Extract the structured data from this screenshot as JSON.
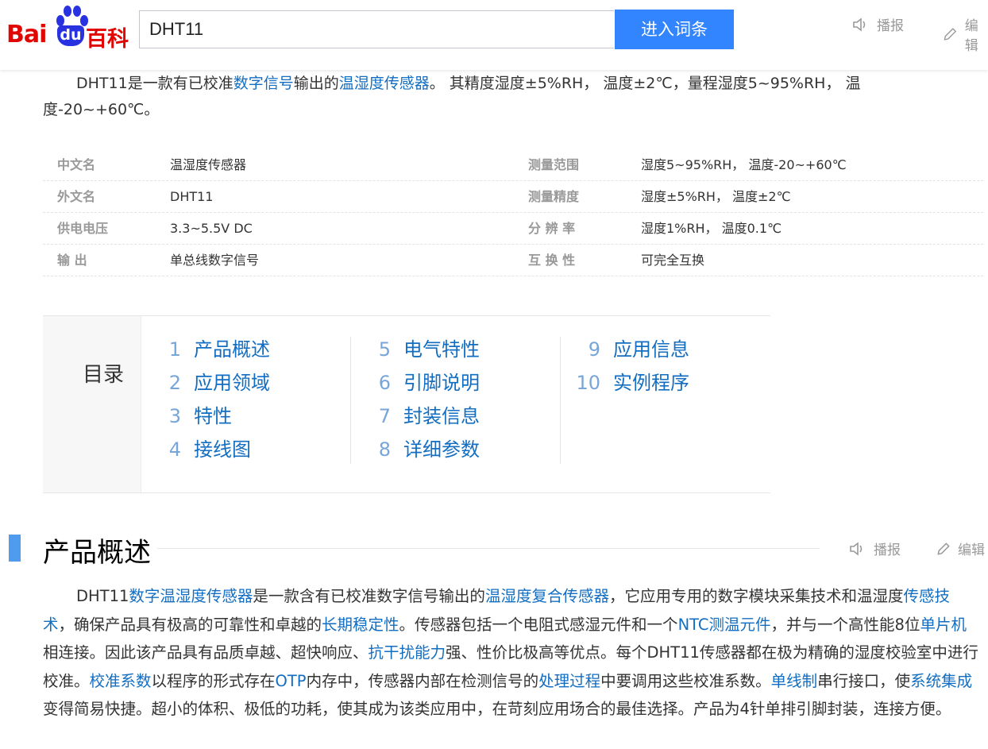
{
  "header": {
    "logo": {
      "bai": "Bai",
      "du": "du",
      "baike": "百科"
    },
    "search_value": "DHT11",
    "search_button": "进入词条",
    "actions": {
      "broadcast": "播报",
      "edit": "编辑"
    }
  },
  "intro": {
    "p1": "DHT11是一款有已校准",
    "link1": "数字信号",
    "p2": "输出的",
    "link2": "温湿度传感器",
    "p3": "。 其精度湿度±5%RH， 温度±2℃，量程湿度5~95%RH， 温度-20~+60℃。"
  },
  "basic_info": [
    {
      "k1": "中文名",
      "v1": "温湿度传感器",
      "k2": "测量范围",
      "v2": "湿度5~95%RH， 温度-20~+60℃"
    },
    {
      "k1": "外文名",
      "v1": "DHT11",
      "k2": "测量精度",
      "v2": "湿度±5%RH， 温度±2℃"
    },
    {
      "k1": "供电电压",
      "v1": "3.3~5.5V DC",
      "k2": "分 辨 率",
      "v2": "湿度1%RH， 温度0.1℃"
    },
    {
      "k1": "输 出",
      "v1": "单总线数字信号",
      "k2": "互 换 性",
      "v2": "可完全互换"
    }
  ],
  "catalog": {
    "title": "目录",
    "items": [
      {
        "num": "1",
        "label": "产品概述"
      },
      {
        "num": "2",
        "label": "应用领域"
      },
      {
        "num": "3",
        "label": "特性"
      },
      {
        "num": "4",
        "label": "接线图"
      },
      {
        "num": "5",
        "label": "电气特性"
      },
      {
        "num": "6",
        "label": "引脚说明"
      },
      {
        "num": "7",
        "label": "封装信息"
      },
      {
        "num": "8",
        "label": "详细参数"
      },
      {
        "num": "9",
        "label": "应用信息"
      },
      {
        "num": "10",
        "label": "实例程序"
      }
    ]
  },
  "section": {
    "title": "产品概述",
    "actions": {
      "broadcast": "播报",
      "edit": "编辑"
    }
  },
  "body": {
    "s1": "DHT11",
    "l1": "数字温湿度传感器",
    "s2": "是一款含有已校准数字信号输出的",
    "l2": "温湿度复合传感器",
    "s3": "，它应用专用的数字模块采集技术和温湿度",
    "l3": "传感技术",
    "s4": "，确保产品具有极高的可靠性和卓越的",
    "l4": "长期稳定性",
    "s5": "。传感器包括一个电阻式感湿元件和一个",
    "l5": "NTC测温元件",
    "s6": "，并与一个高性能8位",
    "l6": "单片机",
    "s7": "相连接。因此该产品具有品质卓越、超快响应、",
    "l7": "抗干扰能力",
    "s8": "强、性价比极高等优点。每个DHT11传感器都在极为精确的湿度校验室中进行校准。",
    "l8": "校准系数",
    "s9": "以程序的形式存在",
    "l9": "OTP",
    "s10": "内存中，传感器内部在检测信号的",
    "l10": "处理过程",
    "s11": "中要调用这些校准系数。",
    "l11": "单线制",
    "s12": "串行接口，使",
    "l12": "系统集成",
    "s13": "变得简易快捷。超小的体积、极低的功耗，使其成为该类应用中，在苛刻应用场合的最佳选择。产品为4针单排引脚封装，连接方便。"
  },
  "colors": {
    "accent": "#3385ff",
    "link": "#136ec2",
    "brand_red": "#e10601",
    "brand_blue": "#2932e1",
    "section_bar": "#4f9cee"
  }
}
